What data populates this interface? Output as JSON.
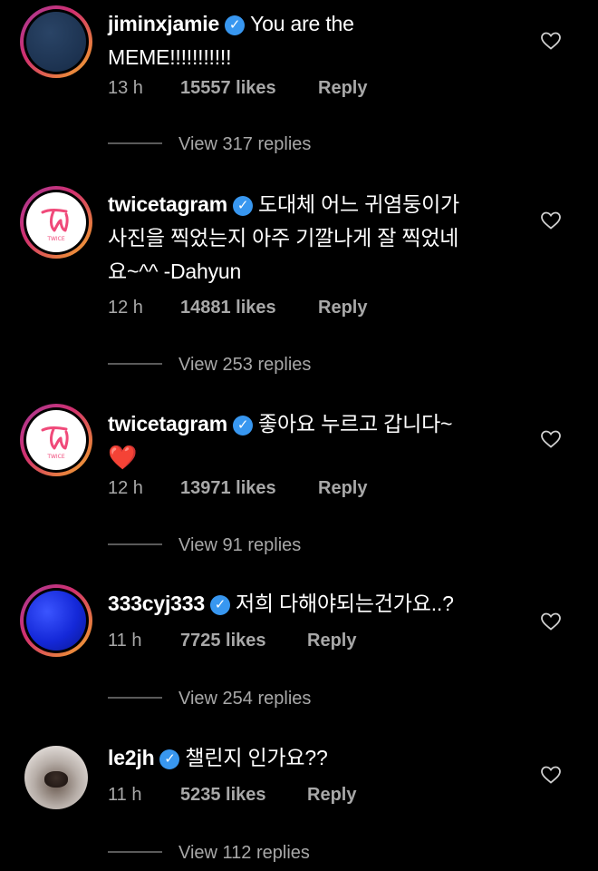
{
  "comments": [
    {
      "username": "jiminxjamie",
      "verified_icon": "verified-badge-icon",
      "text_line1": "You are the",
      "text_line2": "MEME!!!!!!!!!!!",
      "time": "13 h",
      "likes": "15557 likes",
      "reply": "Reply",
      "view_replies": "View 317 replies"
    },
    {
      "username": "twicetagram",
      "verified_icon": "verified-badge-icon",
      "text_line1": "도대체 어느 귀염둥이가",
      "text_line2": "사진을 찍었는지 아주 기깔나게 잘 찍었네",
      "text_line3": "요~^^ -Dahyun",
      "time": "12 h",
      "likes": "14881 likes",
      "reply": "Reply",
      "view_replies": "View 253 replies"
    },
    {
      "username": "twicetagram",
      "verified_icon": "verified-badge-icon",
      "text_line1": "좋아요 누르고 갑니다~",
      "text_line2": "❤️",
      "time": "12 h",
      "likes": "13971 likes",
      "reply": "Reply",
      "view_replies": "View 91 replies"
    },
    {
      "username": "333cyj333",
      "verified_icon": "verified-badge-icon",
      "text_line1": "저희 다해야되는건가요..?",
      "time": "11 h",
      "likes": "7725 likes",
      "reply": "Reply",
      "view_replies": "View 254 replies"
    },
    {
      "username": "le2jh",
      "verified_icon": "verified-badge-icon",
      "text_line1": "챌린지 인가요??",
      "time": "11 h",
      "likes": "5235 likes",
      "reply": "Reply",
      "view_replies": "View 112 replies"
    }
  ],
  "colors": {
    "background": "#000000",
    "text": "#ffffff",
    "meta": "#a8a8a8",
    "verified": "#3897f0",
    "heart_red": "#ff2a2a"
  },
  "icons": {
    "like": "heart-outline-icon",
    "verified": "checkmark-icon"
  }
}
